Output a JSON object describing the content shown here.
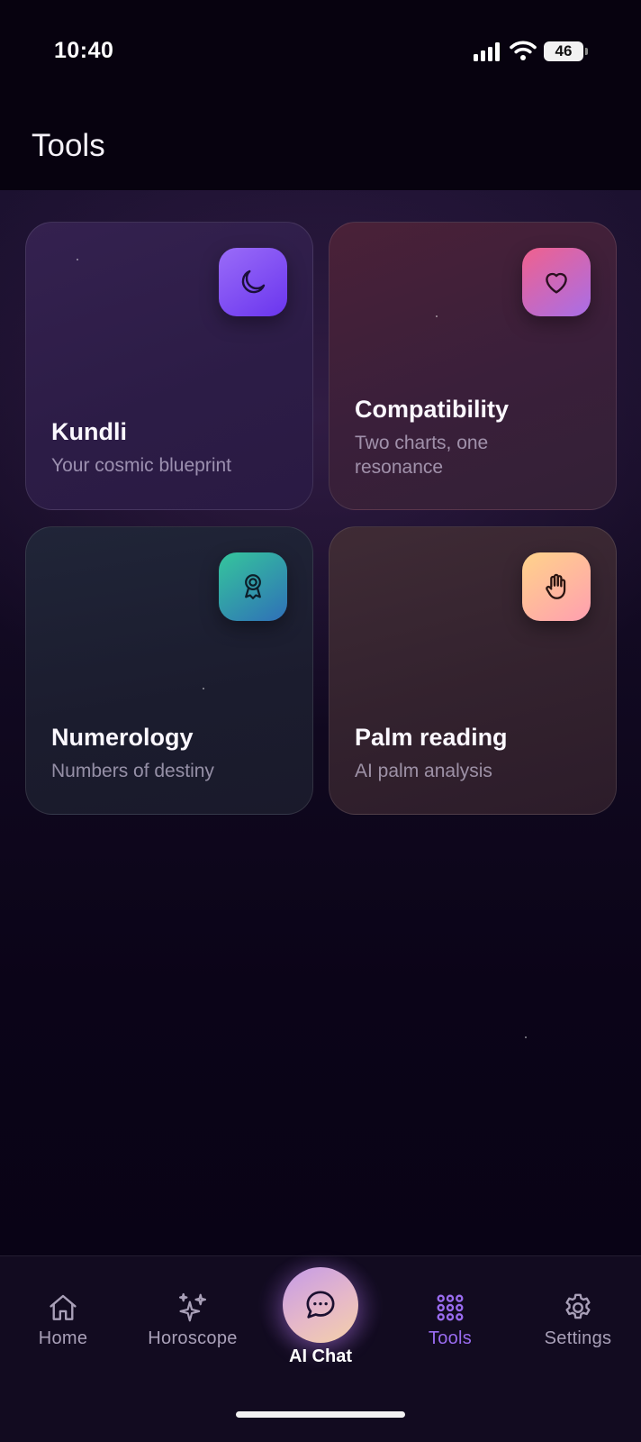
{
  "status_bar": {
    "time": "10:40",
    "battery": "46"
  },
  "header": {
    "title": "Tools"
  },
  "tools": [
    {
      "title": "Kundli",
      "subtitle": "Your cosmic blueprint",
      "icon": "moon-icon"
    },
    {
      "title": "Compatibility",
      "subtitle": "Two charts, one resonance",
      "icon": "heart-icon"
    },
    {
      "title": "Numerology",
      "subtitle": "Numbers of destiny",
      "icon": "award-icon"
    },
    {
      "title": "Palm reading",
      "subtitle": "AI palm analysis",
      "icon": "hand-icon"
    }
  ],
  "tabbar": {
    "items": [
      {
        "label": "Home",
        "icon": "home-icon"
      },
      {
        "label": "Horoscope",
        "icon": "sparkles-icon"
      },
      {
        "label": "AI Chat",
        "icon": "chat-bubble-icon"
      },
      {
        "label": "Tools",
        "icon": "grid-dots-icon",
        "active": true
      },
      {
        "label": "Settings",
        "icon": "gear-icon"
      }
    ]
  },
  "colors": {
    "background": "#0a0418",
    "active_tab": "#9a6cf0",
    "kundli_icon": "#7b45f2",
    "compatibility_icon": "#e2658f",
    "numerology_icon": "#2f9aa8",
    "palm_icon": "#ffb99b"
  }
}
